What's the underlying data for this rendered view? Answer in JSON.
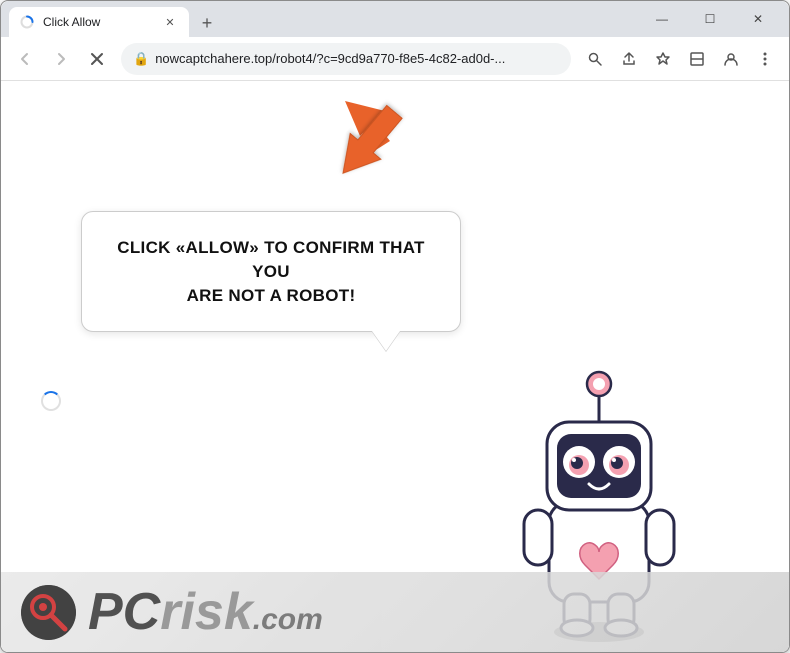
{
  "browser": {
    "tab": {
      "title": "Click Allow",
      "favicon": "spinner"
    },
    "window_controls": {
      "minimize": "—",
      "maximize": "☐",
      "close": "✕"
    },
    "toolbar": {
      "back_label": "←",
      "forward_label": "→",
      "reload_label": "✕",
      "address": "nowcaptchahere.top/robot4/?c=9cd9a770-f8e5-4c82-ad0d-...",
      "search_icon": "🔍",
      "share_icon": "⤴",
      "bookmark_icon": "☆",
      "reader_icon": "▭",
      "profile_icon": "👤",
      "menu_icon": "⋮"
    }
  },
  "page": {
    "bubble_text_line1": "CLICK «ALLOW» TO CONFIRM THAT YOU",
    "bubble_text_line2": "ARE NOT A ROBOT!",
    "watermark": {
      "pc": "PC",
      "risk": "risk",
      "dotcom": ".com"
    }
  }
}
